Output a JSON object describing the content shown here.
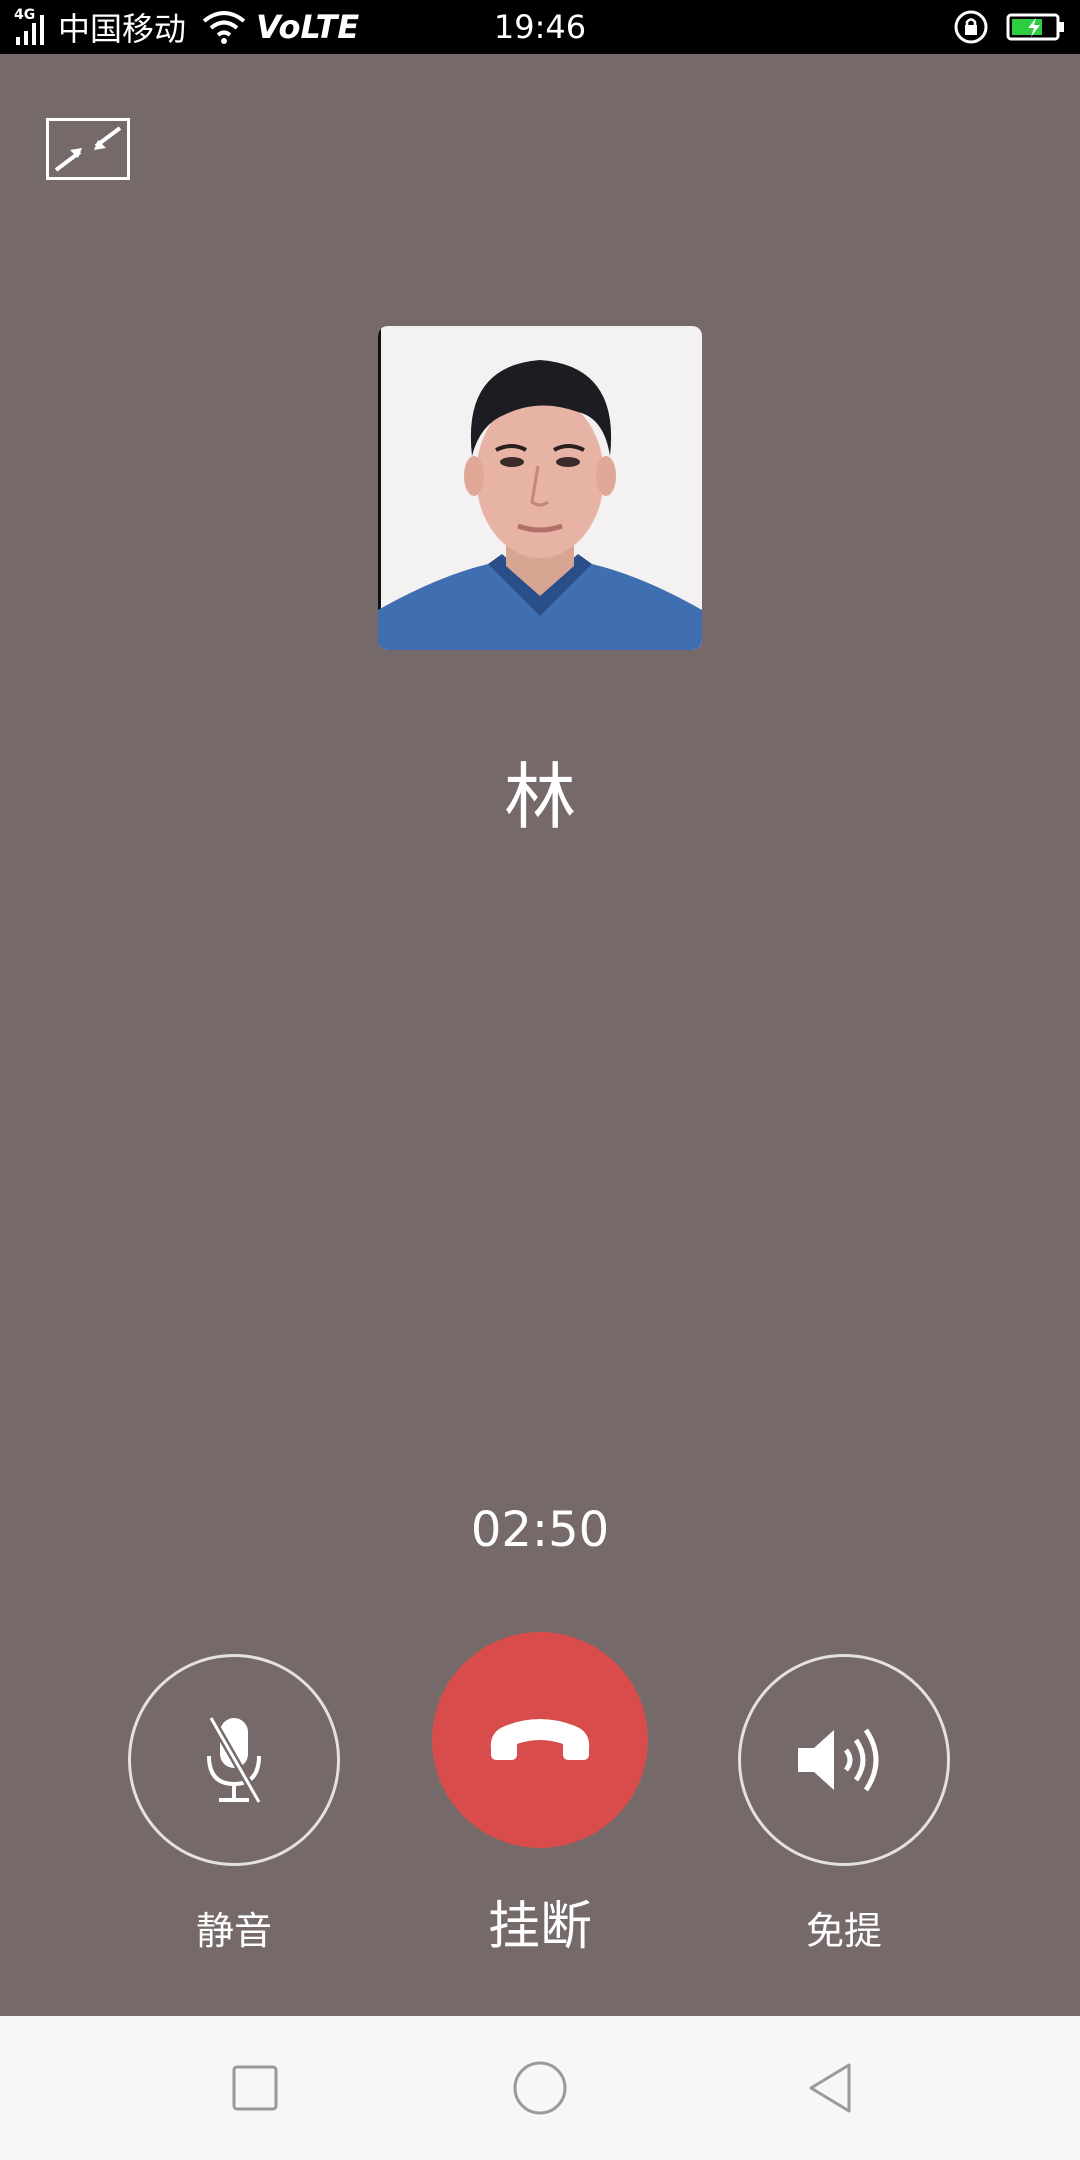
{
  "status_bar": {
    "network_type": "4G",
    "carrier": "中国移动",
    "volte": "VoLTE",
    "time": "19:46",
    "icons": [
      "signal-icon",
      "wifi-icon",
      "rotation-lock-icon",
      "battery-charging-icon"
    ]
  },
  "call": {
    "caller_name": "林",
    "duration": "02:50",
    "avatar_icon": "contact-photo"
  },
  "controls": {
    "mute_label": "静音",
    "hangup_label": "挂断",
    "speaker_label": "免提"
  },
  "colors": {
    "background": "#76696a",
    "hangup": "#d94c4c",
    "battery": "#2ecc40"
  },
  "nav_bar": {
    "icons": [
      "recent-apps-icon",
      "home-icon",
      "back-icon"
    ]
  }
}
